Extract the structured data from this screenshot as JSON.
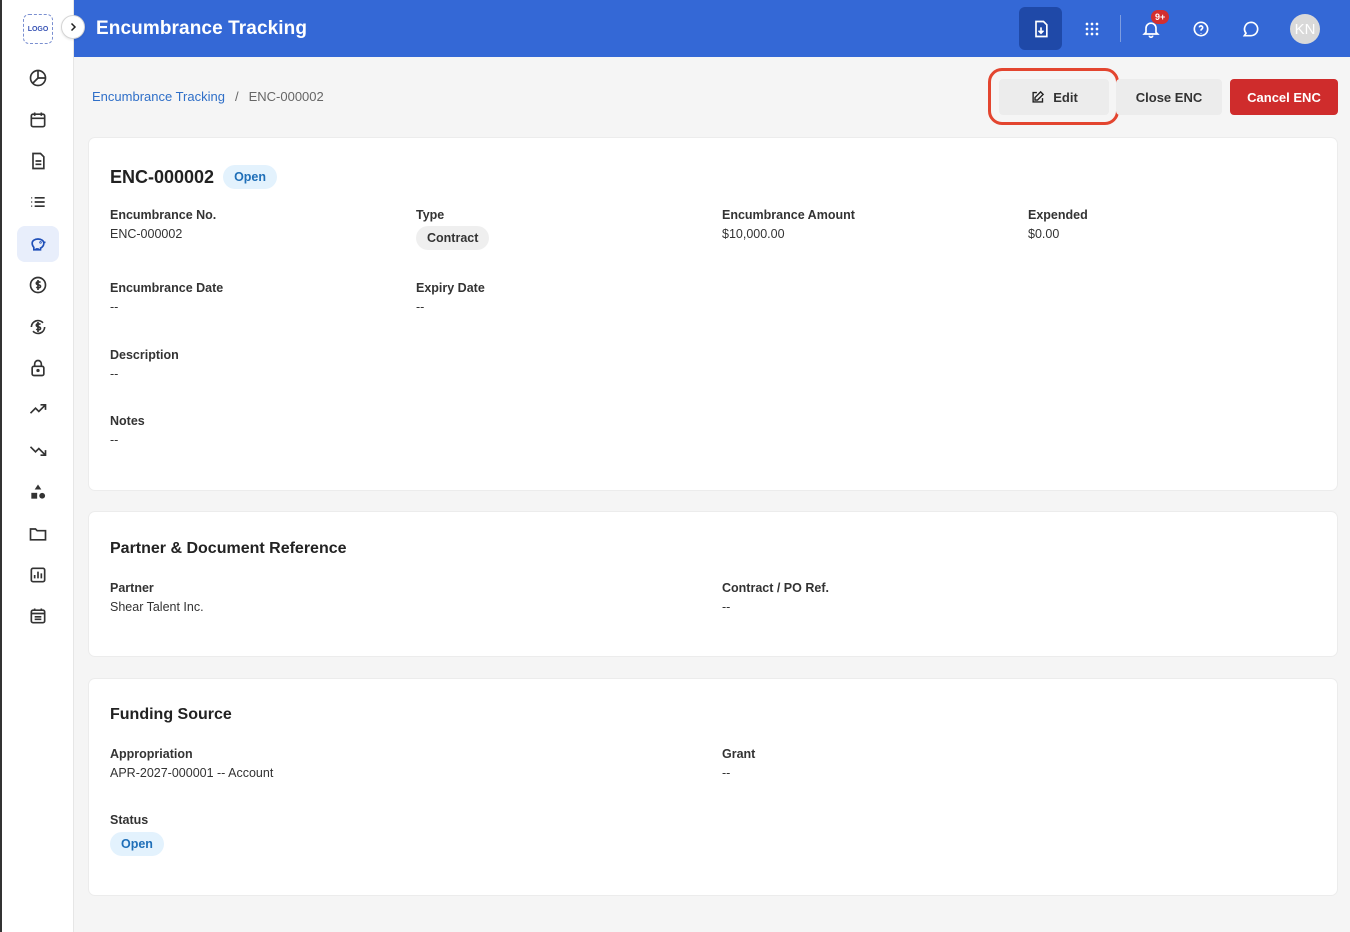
{
  "app": {
    "logo_text": "LOGO",
    "header_title": "Encumbrance Tracking",
    "notification_badge": "9+",
    "avatar_initials": "KN"
  },
  "sidebar": {
    "items": [
      {
        "icon": "pie-chart-icon"
      },
      {
        "icon": "calendar-icon"
      },
      {
        "icon": "document-icon"
      },
      {
        "icon": "list-icon"
      },
      {
        "icon": "piggy-bank-icon",
        "active": true
      },
      {
        "icon": "dollar-circle-icon"
      },
      {
        "icon": "dollar-sync-icon"
      },
      {
        "icon": "lock-icon"
      },
      {
        "icon": "trending-up-icon"
      },
      {
        "icon": "trending-down-icon"
      },
      {
        "icon": "shapes-icon"
      },
      {
        "icon": "folder-icon"
      },
      {
        "icon": "bar-chart-icon"
      },
      {
        "icon": "calendar-list-icon"
      }
    ]
  },
  "breadcrumb": {
    "parent": "Encumbrance Tracking",
    "separator": "/",
    "current": "ENC-000002"
  },
  "actions": {
    "edit": "Edit",
    "close": "Close ENC",
    "cancel": "Cancel ENC"
  },
  "details": {
    "title": "ENC-000002",
    "status_badge": "Open",
    "fields": {
      "enc_no": {
        "label": "Encumbrance No.",
        "value": "ENC-000002"
      },
      "type": {
        "label": "Type",
        "value": "Contract"
      },
      "amount": {
        "label": "Encumbrance Amount",
        "value": "$10,000.00"
      },
      "expended": {
        "label": "Expended",
        "value": "$0.00"
      },
      "enc_date": {
        "label": "Encumbrance Date",
        "value": "--"
      },
      "expiry": {
        "label": "Expiry Date",
        "value": "--"
      },
      "description": {
        "label": "Description",
        "value": "--"
      },
      "notes": {
        "label": "Notes",
        "value": "--"
      }
    }
  },
  "partner_section": {
    "title": "Partner & Document Reference",
    "partner": {
      "label": "Partner",
      "value": "Shear Talent Inc."
    },
    "contract_ref": {
      "label": "Contract / PO Ref.",
      "value": "--"
    }
  },
  "funding_section": {
    "title": "Funding Source",
    "appropriation": {
      "label": "Appropriation",
      "value": "APR-2027-000001 -- Account"
    },
    "grant": {
      "label": "Grant",
      "value": "--"
    },
    "status": {
      "label": "Status",
      "value": "Open"
    }
  },
  "colors": {
    "header": "#3468d6",
    "primary_link": "#2f6fc8",
    "danger": "#cf2c2c",
    "highlight": "#e3452f"
  }
}
